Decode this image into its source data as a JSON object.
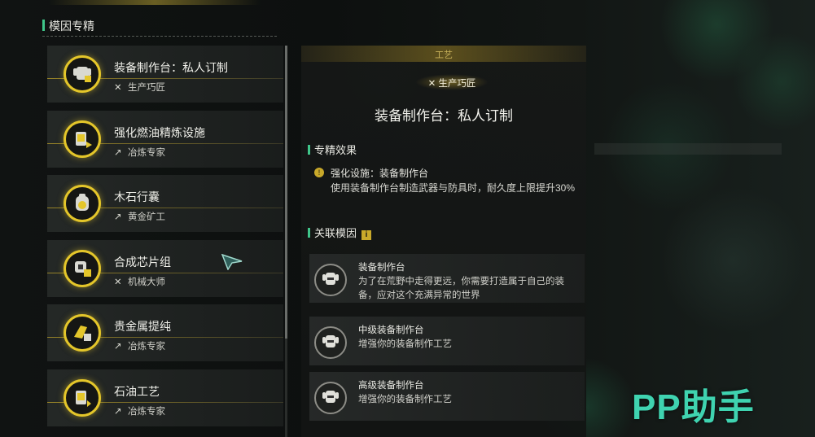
{
  "left_panel": {
    "title": "模因专精",
    "items": [
      {
        "name": "装备制作台：私人订制",
        "role_icon": "tools-icon",
        "role_glyph": "✕",
        "role": "生产巧匠",
        "icon": "armor-icon"
      },
      {
        "name": "强化燃油精炼设施",
        "role_icon": "pickaxe-icon",
        "role_glyph": "↗",
        "role": "冶炼专家",
        "icon": "fuel-icon"
      },
      {
        "name": "木石行囊",
        "role_icon": "pickaxe-icon",
        "role_glyph": "↗",
        "role": "黄金矿工",
        "icon": "backpack-icon"
      },
      {
        "name": "合成芯片组",
        "role_icon": "tools-icon",
        "role_glyph": "✕",
        "role": "机械大师",
        "icon": "chip-icon"
      },
      {
        "name": "贵金属提纯",
        "role_icon": "pickaxe-icon",
        "role_glyph": "↗",
        "role": "冶炼专家",
        "icon": "gold-bar-icon"
      },
      {
        "name": "石油工艺",
        "role_icon": "pickaxe-icon",
        "role_glyph": "↗",
        "role": "冶炼专家",
        "icon": "fuel-icon"
      }
    ]
  },
  "detail": {
    "category": "工艺",
    "role_badge": "✕ 生产巧匠",
    "title": "装备制作台：私人订制",
    "effect_section": "专精效果",
    "effect": {
      "name": "强化设施：装备制作台",
      "desc": "使用装备制作台制造武器与防具时，耐久度上限提升30%"
    },
    "related_section": "关联模因",
    "related_info_glyph": "i",
    "related": [
      {
        "name": "装备制作台",
        "desc": "为了在荒野中走得更远，你需要打造属于自己的装备，应对这个充满异常的世界"
      },
      {
        "name": "中级装备制作台",
        "desc": "增强你的装备制作工艺"
      },
      {
        "name": "高级装备制作台",
        "desc": "增强你的装备制作工艺"
      }
    ]
  },
  "watermark": "PP助手",
  "colors": {
    "accent_gold": "#e4c62a",
    "accent_green": "#3fc68a",
    "watermark": "#3fd3b0"
  }
}
